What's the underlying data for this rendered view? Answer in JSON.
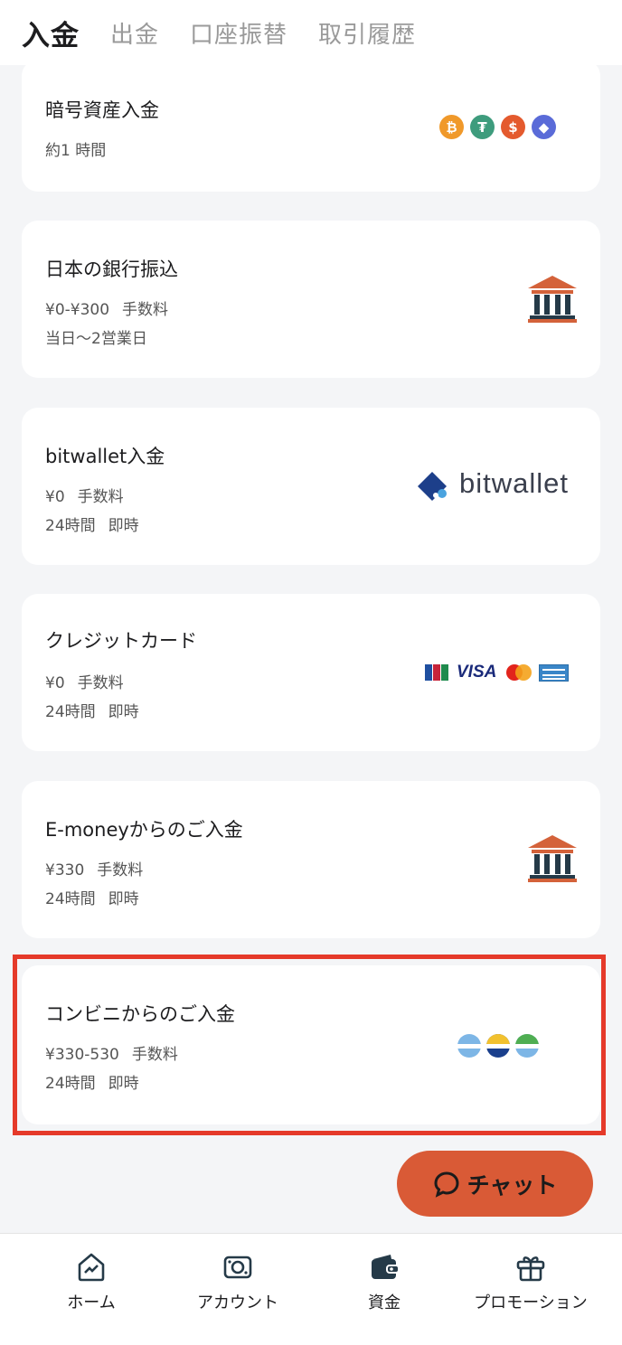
{
  "tabs": [
    {
      "label": "入金",
      "active": true
    },
    {
      "label": "出金",
      "active": false
    },
    {
      "label": "口座振替",
      "active": false
    },
    {
      "label": "取引履歴",
      "active": false
    }
  ],
  "methods": [
    {
      "title": "暗号資産入金",
      "lines": [
        [
          "約1 時間"
        ]
      ],
      "logo": "crypto-coins"
    },
    {
      "title": "日本の銀行振込",
      "lines": [
        [
          "¥0-¥300",
          "手数料"
        ],
        [
          "当日〜2営業日"
        ]
      ],
      "logo": "bank-icon"
    },
    {
      "title": "bitwallet入金",
      "lines": [
        [
          "¥0",
          "手数料"
        ],
        [
          "24時間",
          "即時"
        ]
      ],
      "logo": "bitwallet",
      "logo_text": "bitwallet"
    },
    {
      "title": "クレジットカード",
      "lines": [
        [
          "¥0",
          "手数料"
        ],
        [
          "24時間",
          "即時"
        ]
      ],
      "logo": "card-brands",
      "logo_text": "VISA"
    },
    {
      "title": "E-moneyからのご入金",
      "lines": [
        [
          "¥330",
          "手数料"
        ],
        [
          "24時間",
          "即時"
        ]
      ],
      "logo": "bank-icon"
    },
    {
      "title": "コンビニからのご入金",
      "lines": [
        [
          "¥330-530",
          "手数料"
        ],
        [
          "24時間",
          "即時"
        ]
      ],
      "logo": "convenience-circles"
    }
  ],
  "chat_button": {
    "label": "チャット"
  },
  "bottom_nav": [
    {
      "label": "ホーム",
      "icon": "home-chart-icon"
    },
    {
      "label": "アカウント",
      "icon": "account-icon"
    },
    {
      "label": "資金",
      "icon": "wallet-icon"
    },
    {
      "label": "プロモーション",
      "icon": "gift-icon"
    }
  ],
  "colors": {
    "accent": "#d95a36",
    "highlight": "#e53a2a",
    "bank": "#d4623a",
    "bank_dark": "#253a48"
  }
}
